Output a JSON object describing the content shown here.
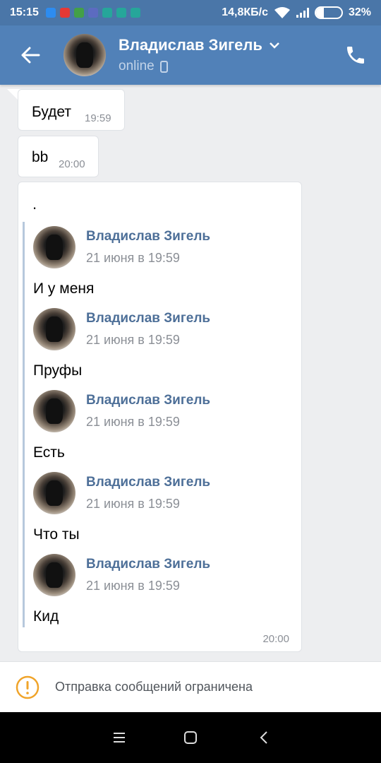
{
  "statusbar": {
    "time": "15:15",
    "speed": "14,8КБ/с",
    "battery": "32%",
    "battery_level": 0.32,
    "notif_colors": [
      "#2d8cf0",
      "#e53935",
      "#43a047",
      "#5c6bc0",
      "#26a69a",
      "#26a69a",
      "#26a69a"
    ]
  },
  "header": {
    "name": "Владислав Зигель",
    "status": "online",
    "back_icon": "arrow-left-icon",
    "call_icon": "phone-icon",
    "accent": "#5181b8"
  },
  "messages": [
    {
      "text": "Будет",
      "time": "19:59"
    },
    {
      "text": "bb",
      "time": "20:00"
    }
  ],
  "forward_message": {
    "text": ".",
    "time": "20:00",
    "forwarded": [
      {
        "author": "Владислав Зигель",
        "date": "21 июня в 19:59",
        "text": "И у меня"
      },
      {
        "author": "Владислав Зигель",
        "date": "21 июня в 19:59",
        "text": "Пруфы"
      },
      {
        "author": "Владислав Зигель",
        "date": "21 июня в 19:59",
        "text": "Есть"
      },
      {
        "author": "Владислав Зигель",
        "date": "21 июня в 19:59",
        "text": "Что ты"
      },
      {
        "author": "Владислав Зигель",
        "date": "21 июня в 19:59",
        "text": "Кид"
      }
    ]
  },
  "restriction": {
    "text": "Отправка сообщений ограничена",
    "icon": "warning-icon",
    "color": "#f0a42a"
  },
  "navbar": {
    "icons": [
      "menu-icon",
      "home-icon",
      "back-icon"
    ]
  }
}
